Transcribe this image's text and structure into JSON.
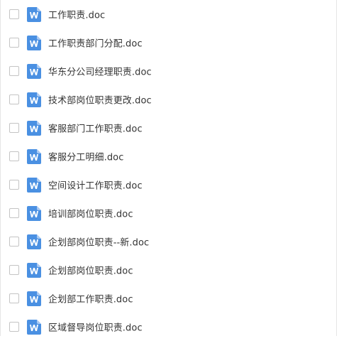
{
  "file_list": {
    "file_icon": "word-doc-icon",
    "accent_color": "#4a90e2",
    "files": [
      {
        "name": "工作职责.doc"
      },
      {
        "name": "工作职责部门分配.doc"
      },
      {
        "name": "华东分公司经理职责.doc"
      },
      {
        "name": "技术部岗位职责更改.doc"
      },
      {
        "name": "客服部门工作职责.doc"
      },
      {
        "name": "客服分工明细.doc"
      },
      {
        "name": "空间设计工作职责.doc"
      },
      {
        "name": "培训部岗位职责.doc"
      },
      {
        "name": "企划部岗位职责--新.doc"
      },
      {
        "name": "企划部岗位职责.doc"
      },
      {
        "name": "企划部工作职责.doc"
      },
      {
        "name": "区域督导岗位职责.doc"
      }
    ]
  }
}
